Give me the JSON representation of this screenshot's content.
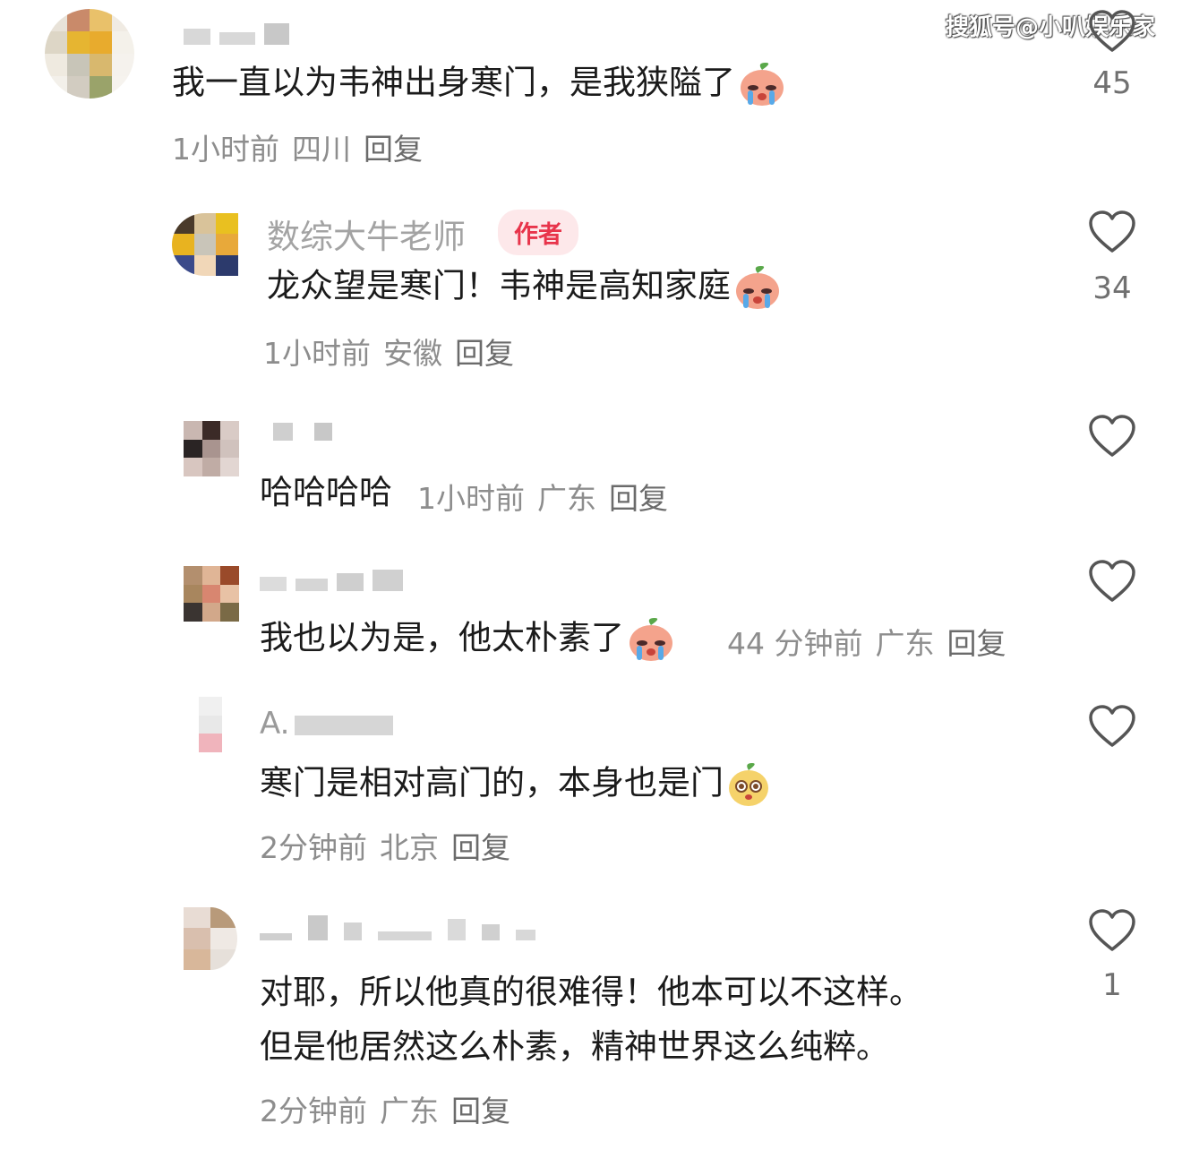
{
  "watermark": "搜狐号@小叭娱乐家",
  "comments": [
    {
      "text": "我一直以为韦神出身寒门，是我狭隘了",
      "emoji": "crying-peach-emoji",
      "time": "1小时前",
      "location": "四川",
      "reply": "回复",
      "likes": "45"
    },
    {
      "author": "数综大牛老师",
      "author_tag": "作者",
      "text": "龙众望是寒门！韦神是高知家庭",
      "emoji": "crying-peach-emoji",
      "time": "1小时前",
      "location": "安徽",
      "reply": "回复",
      "likes": "34"
    },
    {
      "text": "哈哈哈哈",
      "time": "1小时前",
      "location": "广东",
      "reply": "回复",
      "likes": ""
    },
    {
      "text": "我也以为是，他太朴素了",
      "emoji": "crying-peach-emoji",
      "time": "44 分钟前",
      "location": "广东",
      "reply": "回复",
      "likes": ""
    },
    {
      "author": "A.",
      "text": "寒门是相对高门的，本身也是门",
      "emoji": "surprised-bean-emoji",
      "time": "2分钟前",
      "location": "北京",
      "reply": "回复",
      "likes": ""
    },
    {
      "text_line1": "对耶，所以他真的很难得！他本可以不这样。",
      "text_line2": "但是他居然这么朴素，精神世界这么纯粹。",
      "time": "2分钟前",
      "location": "广东",
      "reply": "回复",
      "likes": "1"
    }
  ],
  "icons": {
    "like": "heart-outline-icon"
  },
  "colors": {
    "author_tag_text": "#e8344b",
    "author_tag_bg": "#fde8ea",
    "meta": "#8d8d8d"
  }
}
